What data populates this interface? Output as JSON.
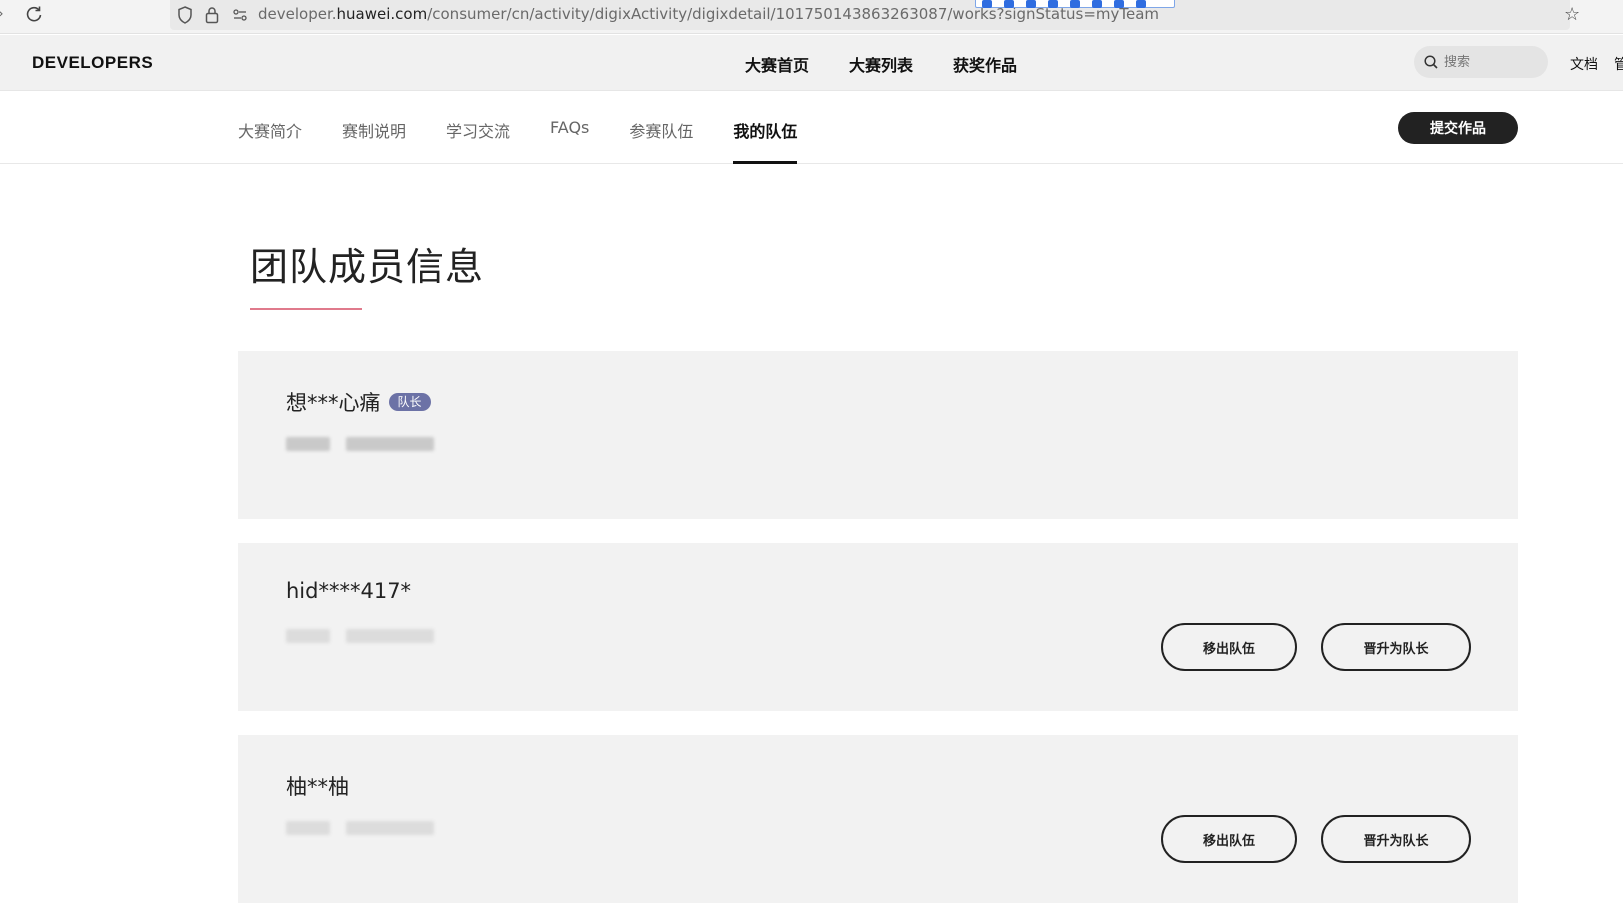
{
  "browser": {
    "url_prefix": "developer.",
    "url_domain": "huawei.com",
    "url_path": "/consumer/cn/activity/digixActivity/digixdetail/101750143863263087/works?signStatus=myTeam"
  },
  "header": {
    "brand": "DEVELOPERS",
    "nav": [
      "大赛首页",
      "大赛列表",
      "获奖作品"
    ],
    "search_placeholder": "搜索",
    "docs_label": "文档",
    "cut_label": "管"
  },
  "subnav": {
    "tabs": [
      "大赛简介",
      "赛制说明",
      "学习交流",
      "FAQs",
      "参赛队伍",
      "我的队伍"
    ],
    "active_index": 5,
    "submit_label": "提交作品"
  },
  "main": {
    "title": "团队成员信息",
    "members": [
      {
        "name": "想***心痛",
        "badge": "队长"
      },
      {
        "name": "hid****417*",
        "remove_label": "移出队伍",
        "promote_label": "晋升为队长"
      },
      {
        "name": "柚**柚",
        "remove_label": "移出队伍",
        "promote_label": "晋升为队长"
      }
    ]
  },
  "colors": {
    "accent_underline": "#e07a8c",
    "badge": "#6c72a6",
    "card_bg": "#f2f2f2"
  }
}
